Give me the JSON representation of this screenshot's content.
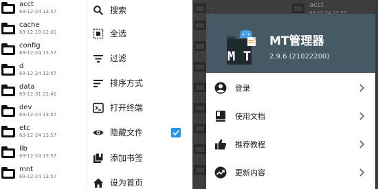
{
  "file_list": [
    {
      "name": "acct",
      "date": "69-12-24 13:57"
    },
    {
      "name": "cache",
      "date": "69-12-19 02:01"
    },
    {
      "name": "config",
      "date": "69-12-24 13:57"
    },
    {
      "name": "d",
      "date": "69-12-24 13:57"
    },
    {
      "name": "data",
      "date": "69-12-31 22:41"
    },
    {
      "name": "dev",
      "date": "69-12-24 13:57"
    },
    {
      "name": "etc",
      "date": "69-12-24 13:57"
    },
    {
      "name": "lib",
      "date": "69-12-24 13:57"
    },
    {
      "name": "mnt",
      "date": "69-12-24 13:57"
    }
  ],
  "menu": {
    "items": [
      {
        "label": "搜索",
        "icon": "search-icon"
      },
      {
        "label": "全选",
        "icon": "select-all-icon"
      },
      {
        "label": "过滤",
        "icon": "filter-icon"
      },
      {
        "label": "排序方式",
        "icon": "sort-icon"
      },
      {
        "label": "打开终端",
        "icon": "terminal-icon"
      },
      {
        "label": "隐藏文件",
        "icon": "eye-icon",
        "checked": true
      },
      {
        "label": "添加书签",
        "icon": "bookmark-add-icon"
      },
      {
        "label": "设为首页",
        "icon": "home-icon"
      }
    ],
    "accent_color": "#2196f3"
  },
  "background_panel": {
    "top_label": "..",
    "name": "acct",
    "date": "69-12-24 13:57"
  },
  "drawer": {
    "header_color": "#455a64",
    "app_name": "MT管理器",
    "version": "2.9.6 (21022200)",
    "logo_text": "M T",
    "items": [
      {
        "label": "登录",
        "icon": "account-icon"
      },
      {
        "label": "使用文档",
        "icon": "book-icon"
      },
      {
        "label": "推荐教程",
        "icon": "thumb-up-icon"
      },
      {
        "label": "更新内容",
        "icon": "trending-icon"
      }
    ]
  }
}
